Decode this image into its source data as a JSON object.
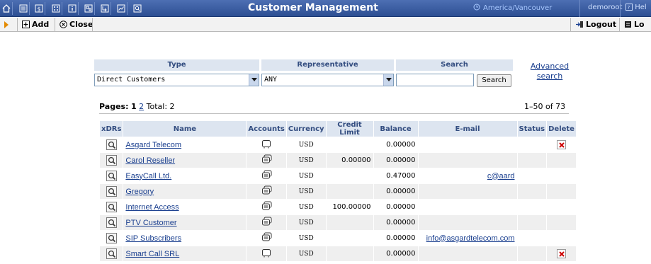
{
  "header": {
    "title": "Customer Management",
    "timezone": "America/Vancouver",
    "user": "demoroot",
    "help": "Hel",
    "icons": [
      "home-icon",
      "list-icon",
      "dollar-icon",
      "grid-icon",
      "info-icon",
      "doc-icon",
      "transfer-icon",
      "chart-icon",
      "search-icon"
    ]
  },
  "toolbar": {
    "add_label": "Add",
    "close_label": "Close",
    "logout_label": "Logout",
    "lo_label": "Lo"
  },
  "filter": {
    "type_header": "Type",
    "type_value": "Direct Customers",
    "rep_header": "Representative",
    "rep_value": "ANY",
    "search_header": "Search",
    "search_value": "",
    "search_button": "Search",
    "advanced_line1": "Advanced",
    "advanced_line2": "search"
  },
  "pagination": {
    "label": "Pages:",
    "current": "1",
    "next": "2",
    "total_label": "Total: 2",
    "range": "1–50 of 73"
  },
  "table": {
    "columns": [
      "xDRs",
      "Name",
      "Accounts",
      "Currency",
      "Credit Limit",
      "Balance",
      "E-mail",
      "Status",
      "Delete"
    ],
    "rows": [
      {
        "name": "Asgard Telecom",
        "accounts_icon": "single-account-icon",
        "currency": "USD",
        "credit_limit": "",
        "balance": "0.00000",
        "email": "",
        "status": "",
        "delete": true
      },
      {
        "name": "Carol Reseller",
        "accounts_icon": "multi-account-icon",
        "currency": "USD",
        "credit_limit": "0.00000",
        "balance": "0.00000",
        "email": "",
        "status": "",
        "delete": false
      },
      {
        "name": "EasyCall Ltd.",
        "accounts_icon": "multi-account-icon",
        "currency": "USD",
        "credit_limit": "",
        "balance": "0.47000",
        "email": "c@aard",
        "status": "",
        "delete": false
      },
      {
        "name": "Gregory",
        "accounts_icon": "multi-account-icon",
        "currency": "USD",
        "credit_limit": "",
        "balance": "0.00000",
        "email": "",
        "status": "",
        "delete": false
      },
      {
        "name": "Internet Access",
        "accounts_icon": "multi-account-icon",
        "currency": "USD",
        "credit_limit": "100.00000",
        "balance": "0.00000",
        "email": "",
        "status": "",
        "delete": false
      },
      {
        "name": "PTV Customer",
        "accounts_icon": "multi-account-icon",
        "currency": "USD",
        "credit_limit": "",
        "balance": "0.00000",
        "email": "",
        "status": "",
        "delete": false
      },
      {
        "name": "SIP Subscribers",
        "accounts_icon": "multi-account-icon",
        "currency": "USD",
        "credit_limit": "",
        "balance": "0.00000",
        "email": "info@asgardtelecom.com",
        "status": "",
        "delete": false
      },
      {
        "name": "Smart Call SRL",
        "accounts_icon": "single-account-icon",
        "currency": "USD",
        "credit_limit": "",
        "balance": "0.00000",
        "email": "",
        "status": "",
        "delete": true
      }
    ]
  },
  "colors": {
    "header_bar": "#2d4f93",
    "table_header_bg": "#dde5f0",
    "link": "#1a3f8f",
    "delete_x": "#cc0000",
    "toolbar_arrow": "#e38a00"
  }
}
